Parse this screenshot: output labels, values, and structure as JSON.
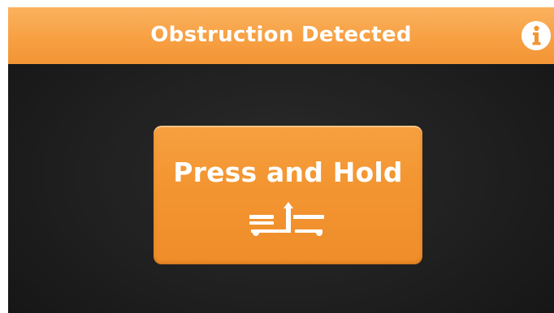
{
  "header": {
    "title": "Obstruction Detected",
    "info_icon": "info-icon",
    "background_color": "#f7a043"
  },
  "action": {
    "label": "Press and Hold",
    "icon": "raise-arrow-icon",
    "background_color": "#f39632"
  },
  "screen": {
    "background_color": "#1f1f1f"
  }
}
